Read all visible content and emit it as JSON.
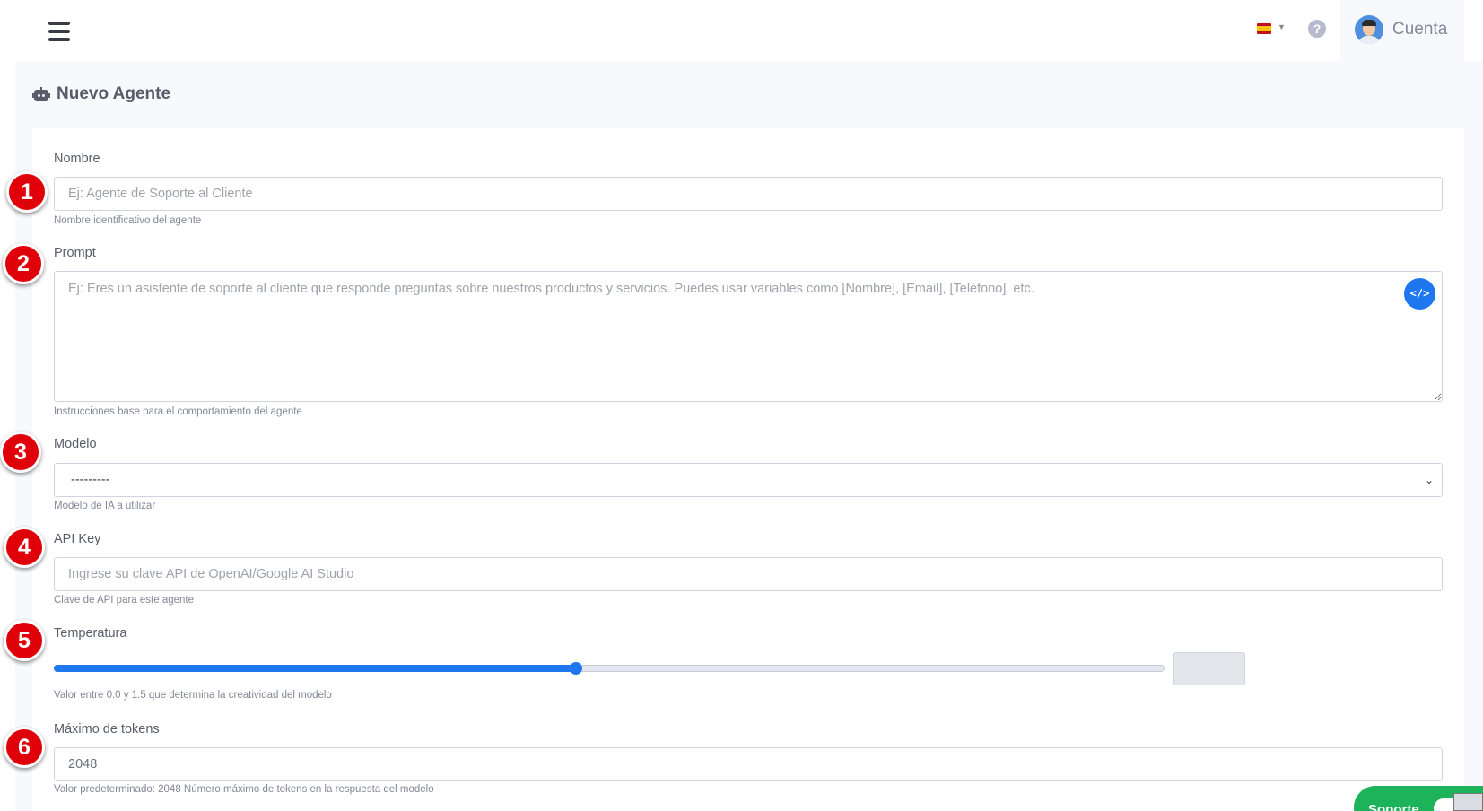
{
  "topbar": {
    "menu_icon": "hamburger-icon",
    "language_flag": "spain-flag-icon",
    "help_icon": "question-circle-icon",
    "account_label": "Cuenta"
  },
  "page": {
    "title": "Nuevo Agente",
    "title_icon": "robot-icon"
  },
  "form": {
    "nombre": {
      "label": "Nombre",
      "placeholder": "Ej: Agente de Soporte al Cliente",
      "value": "",
      "help": "Nombre identificativo del agente"
    },
    "prompt": {
      "label": "Prompt",
      "placeholder": "Ej: Eres un asistente de soporte al cliente que responde preguntas sobre nuestros productos y servicios. Puedes usar variables como [Nombre], [Email], [Teléfono], etc.",
      "value": "",
      "help": "Instrucciones base para el comportamiento del agente",
      "variables_button_icon": "code-icon"
    },
    "modelo": {
      "label": "Modelo",
      "selected": "---------",
      "help": "Modelo de IA a utilizar"
    },
    "api_key": {
      "label": "API Key",
      "placeholder": "Ingrese su clave API de OpenAI/Google AI Studio",
      "value": "",
      "help": "Clave de API para este agente"
    },
    "temperatura": {
      "label": "Temperatura",
      "min": 0.0,
      "max": 1.5,
      "value_fraction": 0.47,
      "help": "Valor entre 0.0 y 1.5 que determina la creatividad del modelo"
    },
    "max_tokens": {
      "label": "Máximo de tokens",
      "value": "2048",
      "help": "Valor predeterminado: 2048 Número máximo de tokens en la respuesta del modelo"
    }
  },
  "markers": [
    "1",
    "2",
    "3",
    "4",
    "5",
    "6"
  ],
  "support": {
    "label": "Soporte"
  },
  "colors": {
    "primary": "#1f77f0",
    "marker": "#e0000a",
    "support": "#1cb35a"
  }
}
